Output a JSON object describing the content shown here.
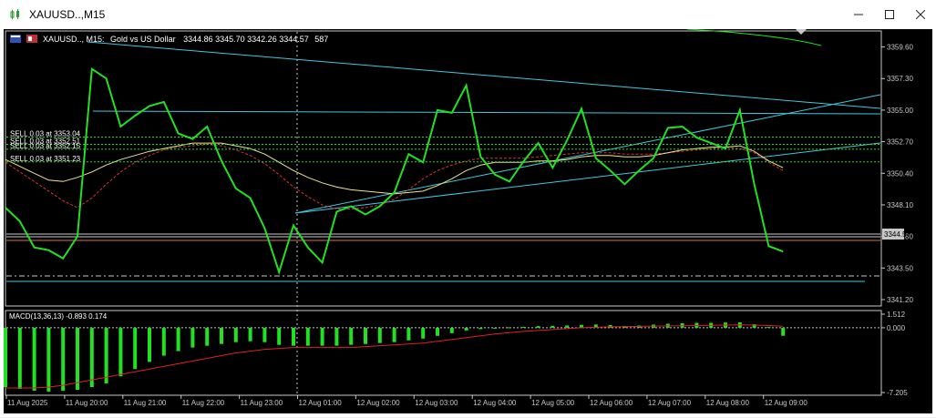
{
  "window": {
    "title": "XAUUSD..,M15",
    "minimize_icon": "minimize-icon",
    "maximize_icon": "maximize-icon",
    "close_icon": "close-icon"
  },
  "chart_header": {
    "symbol_period": "XAUUSD.., M15:",
    "description": "Gold vs US Dollar",
    "ohlc": "3344.86 3345.70 3342.26 3344.57",
    "volume": "587"
  },
  "orders": [
    {
      "label": "SELL 0.03 at 3353.04",
      "price": 3353.04
    },
    {
      "label": "SELL 0.03 at 3352.51",
      "price": 3352.51
    },
    {
      "label": "SELL 0.03 at 3352.15",
      "price": 3352.15
    },
    {
      "label": "SELL 0.03 at 3351.23",
      "price": 3351.23
    }
  ],
  "current_price_label": "3344.57",
  "colors": {
    "background": "#000000",
    "price_line": "#22e022",
    "ma_fast": "#f0e68c",
    "ma_slow": "#e03030",
    "trendline": "#40c8e0",
    "macd_hist": "#22e022",
    "macd_signal": "#e02020",
    "grid_text": "#c8c8c8"
  },
  "chart_data": [
    {
      "type": "line",
      "ylim": [
        3341.0,
        3360.5
      ],
      "y_ticks": [
        "3359.60",
        "3357.30",
        "3355.00",
        "3352.70",
        "3350.40",
        "3348.10",
        "3345.80",
        "3343.50",
        "3341.20"
      ],
      "x_ticks": [
        "11 Aug 2025",
        "11 Aug 20:00",
        "11 Aug 21:00",
        "11 Aug 22:00",
        "11 Aug 23:00",
        "12 Aug 01:00",
        "12 Aug 02:00",
        "12 Aug 03:00",
        "12 Aug 04:00",
        "12 Aug 05:00",
        "12 Aug 06:00",
        "12 Aug 07:00",
        "12 Aug 08:00",
        "12 Aug 09:00"
      ],
      "series": [
        {
          "values": [
            3347.9,
            3346.9,
            3345.0,
            3344.8,
            3344.2,
            3345.8,
            3358.0,
            3357.3,
            3353.8,
            3354.6,
            3355.3,
            3355.6,
            3353.3,
            3352.9,
            3353.8,
            3351.3,
            3349.3,
            3348.6,
            3346.4,
            3343.2,
            3346.6,
            3345.0,
            3343.9,
            3347.6,
            3348.0,
            3347.4,
            3348.0,
            3349.0,
            3351.8,
            3351.2,
            3355.0,
            3354.8,
            3356.8,
            3351.6,
            3350.3,
            3349.8,
            3351.3,
            3352.6,
            3350.8,
            3352.8,
            3355.1,
            3351.5,
            3350.6,
            3349.6,
            3350.6,
            3351.5,
            3353.7,
            3353.8,
            3353.0,
            3352.6,
            3352.2,
            3355.0,
            3349.6,
            3345.1,
            3344.7
          ]
        }
      ],
      "ma_fast": [
        3351.4,
        3350.9,
        3350.4,
        3349.9,
        3349.8,
        3350.1,
        3350.5,
        3351.0,
        3351.4,
        3351.7,
        3352.0,
        3352.2,
        3352.4,
        3352.6,
        3352.6,
        3352.6,
        3352.4,
        3352.2,
        3351.8,
        3351.2,
        3350.6,
        3350.1,
        3349.7,
        3349.4,
        3349.2,
        3349.1,
        3349.0,
        3348.9,
        3349.0,
        3349.1,
        3349.5,
        3350.0,
        3350.6,
        3351.0,
        3351.2,
        3351.2,
        3351.2,
        3351.3,
        3351.3,
        3351.4,
        3351.6,
        3351.7,
        3351.7,
        3351.6,
        3351.6,
        3351.7,
        3351.9,
        3352.1,
        3352.2,
        3352.3,
        3352.3,
        3352.4,
        3352.0,
        3351.3,
        3350.8
      ],
      "ma_slow": [
        3351.2,
        3350.5,
        3349.8,
        3349.1,
        3348.4,
        3347.9,
        3348.6,
        3349.6,
        3350.5,
        3351.2,
        3351.7,
        3352.1,
        3352.3,
        3352.4,
        3352.5,
        3352.4,
        3352.1,
        3351.7,
        3351.1,
        3350.3,
        3349.4,
        3348.7,
        3348.1,
        3347.8,
        3347.8,
        3347.9,
        3348.1,
        3348.5,
        3349.2,
        3350.0,
        3350.6,
        3351.0,
        3351.3,
        3351.5,
        3351.5,
        3351.5,
        3351.5,
        3351.6,
        3351.7,
        3351.8,
        3351.9,
        3351.9,
        3351.9,
        3351.8,
        3351.8,
        3351.8,
        3351.9,
        3352.0,
        3352.1,
        3352.2,
        3352.3,
        3352.2,
        3351.9,
        3351.2,
        3350.6
      ]
    },
    {
      "type": "bar",
      "title": "MACD(13,36,13) -0.893 0.174",
      "ylim": [
        -7.205,
        1.512
      ],
      "y_ticks": [
        "1.512",
        "0.000",
        "-7.205"
      ],
      "values": [
        -6.6,
        -6.8,
        -7.0,
        -7.1,
        -7.0,
        -6.9,
        -6.6,
        -6.2,
        -5.4,
        -4.6,
        -3.8,
        -3.1,
        -2.6,
        -2.2,
        -2.0,
        -1.8,
        -1.6,
        -1.5,
        -1.6,
        -1.9,
        -2.0,
        -2.0,
        -2.0,
        -2.0,
        -1.9,
        -1.8,
        -1.7,
        -1.6,
        -1.4,
        -1.2,
        -0.9,
        -0.6,
        -0.3,
        -0.15,
        -0.05,
        0.05,
        0.1,
        0.18,
        0.22,
        0.25,
        0.32,
        0.36,
        0.3,
        0.2,
        0.25,
        0.35,
        0.45,
        0.5,
        0.55,
        0.55,
        0.58,
        0.6,
        0.4,
        0.1,
        -0.893
      ],
      "signal": [
        -6.7,
        -6.7,
        -6.7,
        -6.6,
        -6.4,
        -6.1,
        -5.8,
        -5.5,
        -5.2,
        -4.9,
        -4.6,
        -4.3,
        -4.0,
        -3.7,
        -3.4,
        -3.1,
        -2.8,
        -2.6,
        -2.4,
        -2.3,
        -2.2,
        -2.2,
        -2.2,
        -2.2,
        -2.2,
        -2.1,
        -2.0,
        -1.9,
        -1.8,
        -1.7,
        -1.5,
        -1.3,
        -1.1,
        -0.9,
        -0.7,
        -0.55,
        -0.4,
        -0.3,
        -0.2,
        -0.1,
        0.0,
        0.05,
        0.1,
        0.12,
        0.15,
        0.18,
        0.2,
        0.22,
        0.25,
        0.28,
        0.3,
        0.32,
        0.3,
        0.25,
        0.174
      ]
    }
  ]
}
